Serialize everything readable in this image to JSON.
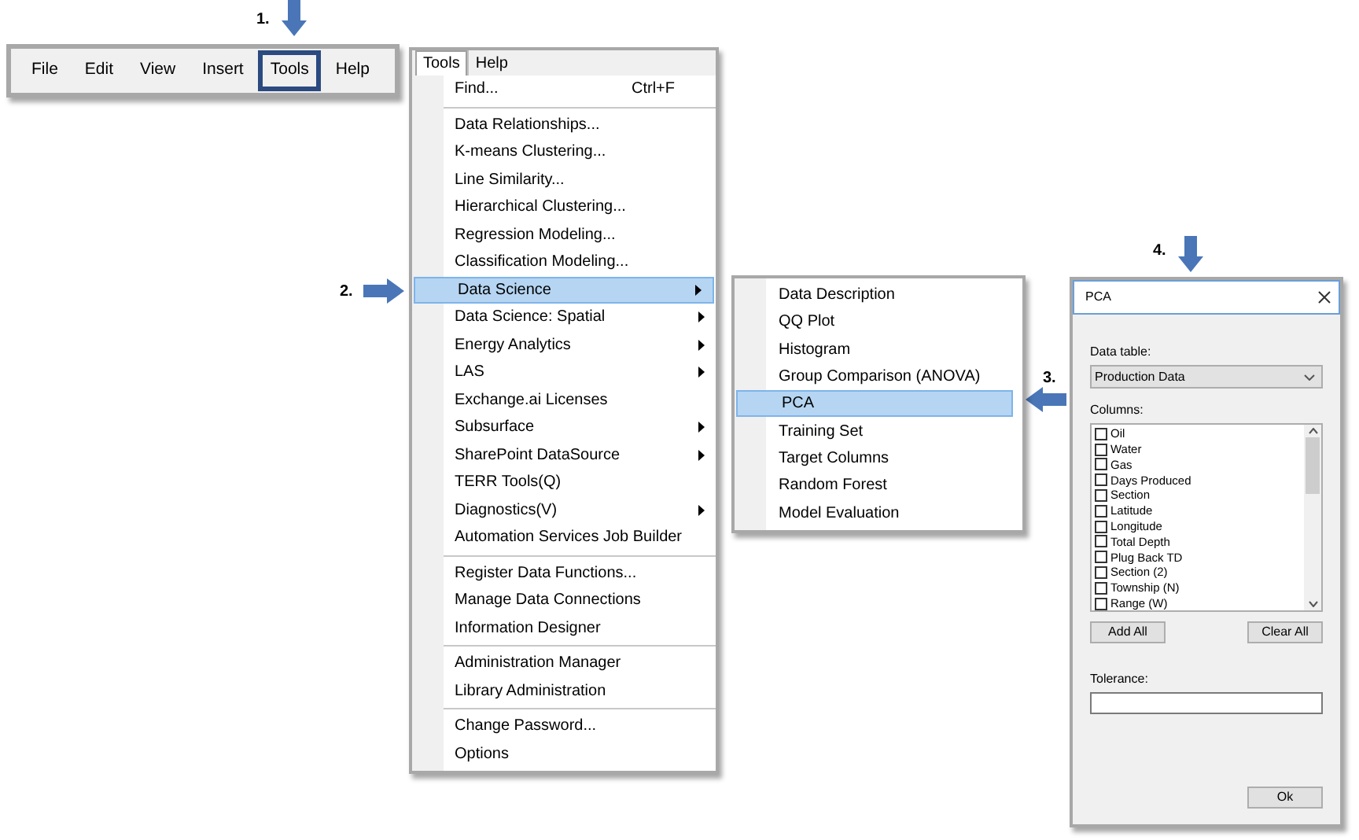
{
  "steps": [
    {
      "label": "1.",
      "kind": "down"
    },
    {
      "label": "2.",
      "kind": "right"
    },
    {
      "label": "3.",
      "kind": "left"
    },
    {
      "label": "4.",
      "kind": "down"
    }
  ],
  "menu_bar": {
    "items": [
      {
        "label": "File",
        "selected": false
      },
      {
        "label": "Edit",
        "selected": false
      },
      {
        "label": "View",
        "selected": false
      },
      {
        "label": "Insert",
        "selected": false
      },
      {
        "label": "Tools",
        "selected": true
      },
      {
        "label": "Help",
        "selected": false
      }
    ]
  },
  "tools_menu": {
    "tabs": [
      {
        "label": "Tools",
        "selected": true
      },
      {
        "label": "Help",
        "selected": false
      }
    ],
    "groups": [
      [
        {
          "label": "Find...",
          "shortcut": "Ctrl+F",
          "submenu": false,
          "selected": false
        }
      ],
      [
        {
          "label": "Data Relationships...",
          "submenu": false,
          "selected": false
        },
        {
          "label": "K-means Clustering...",
          "submenu": false,
          "selected": false
        },
        {
          "label": "Line Similarity...",
          "submenu": false,
          "selected": false
        },
        {
          "label": "Hierarchical Clustering...",
          "submenu": false,
          "selected": false
        },
        {
          "label": "Regression Modeling...",
          "submenu": false,
          "selected": false
        },
        {
          "label": "Classification Modeling...",
          "submenu": false,
          "selected": false
        },
        {
          "label": "Data Science",
          "submenu": true,
          "selected": true
        },
        {
          "label": "Data Science: Spatial",
          "submenu": true,
          "selected": false
        },
        {
          "label": "Energy Analytics",
          "submenu": true,
          "selected": false
        },
        {
          "label": "LAS",
          "submenu": true,
          "selected": false
        },
        {
          "label": "Exchange.ai Licenses",
          "submenu": false,
          "selected": false
        },
        {
          "label": "Subsurface",
          "submenu": true,
          "selected": false
        },
        {
          "label": "SharePoint DataSource",
          "submenu": true,
          "selected": false
        },
        {
          "label": "TERR Tools(Q)",
          "submenu": false,
          "selected": false
        },
        {
          "label": "Diagnostics(V)",
          "submenu": true,
          "selected": false
        },
        {
          "label": "Automation Services Job Builder",
          "submenu": false,
          "selected": false
        }
      ],
      [
        {
          "label": "Register Data Functions...",
          "submenu": false,
          "selected": false
        },
        {
          "label": "Manage Data Connections",
          "submenu": false,
          "selected": false
        },
        {
          "label": "Information Designer",
          "submenu": false,
          "selected": false
        }
      ],
      [
        {
          "label": "Administration Manager",
          "submenu": false,
          "selected": false
        },
        {
          "label": "Library Administration",
          "submenu": false,
          "selected": false
        }
      ],
      [
        {
          "label": "Change Password...",
          "submenu": false,
          "selected": false
        },
        {
          "label": "Options",
          "submenu": false,
          "selected": false
        }
      ]
    ]
  },
  "data_science_menu": {
    "items": [
      {
        "label": "Data Description",
        "selected": false
      },
      {
        "label": "QQ Plot",
        "selected": false
      },
      {
        "label": "Histogram",
        "selected": false
      },
      {
        "label": "Group Comparison (ANOVA)",
        "selected": false
      },
      {
        "label": "PCA",
        "selected": true
      },
      {
        "label": "Training Set",
        "selected": false
      },
      {
        "label": "Target Columns",
        "selected": false
      },
      {
        "label": "Random Forest",
        "selected": false
      },
      {
        "label": "Model Evaluation",
        "selected": false
      }
    ]
  },
  "dialog": {
    "title": "PCA",
    "data_table_label": "Data table:",
    "data_table_value": "Production Data",
    "columns_label": "Columns:",
    "columns": [
      {
        "label": "Oil",
        "checked": false
      },
      {
        "label": "Water",
        "checked": false
      },
      {
        "label": "Gas",
        "checked": false
      },
      {
        "label": "Days Produced",
        "checked": false
      },
      {
        "label": "Section",
        "checked": false
      },
      {
        "label": "Latitude",
        "checked": false
      },
      {
        "label": "Longitude",
        "checked": false
      },
      {
        "label": "Total Depth",
        "checked": false
      },
      {
        "label": "Plug Back TD",
        "checked": false
      },
      {
        "label": "Section (2)",
        "checked": false
      },
      {
        "label": "Township (N)",
        "checked": false
      },
      {
        "label": "Range (W)",
        "checked": false
      }
    ],
    "add_all": "Add All",
    "clear_all": "Clear All",
    "tolerance_label": "Tolerance:",
    "ok": "Ok"
  }
}
